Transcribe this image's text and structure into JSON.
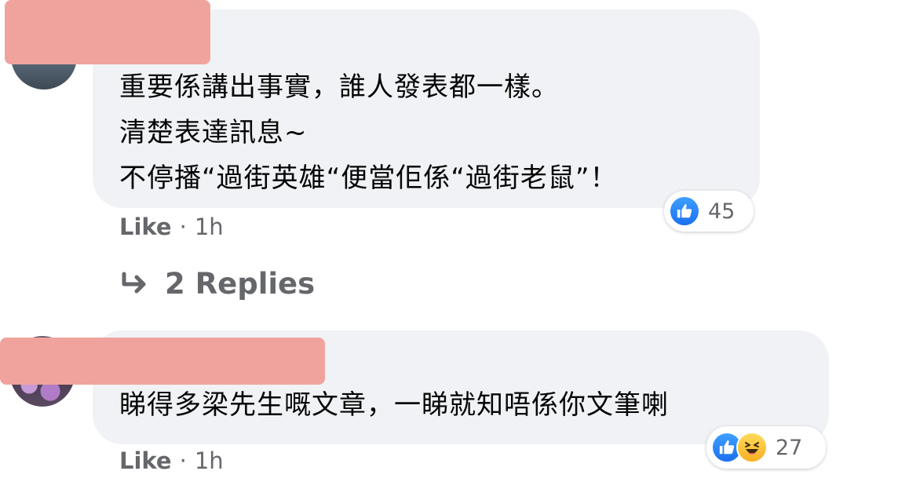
{
  "comments": [
    {
      "text": "重要係講出事實，誰人發表都一樣。\n清楚表達訊息~\n不停播“過街英雄“便當佢係“過街老鼠”！",
      "reaction_count": "45",
      "like_label": "Like",
      "separator": "·",
      "time": "1h",
      "reactions": [
        "like-icon"
      ]
    },
    {
      "text": "睇得多梁先生嘅文章，一睇就知唔係你文筆喇",
      "reaction_count": "27",
      "like_label": "Like",
      "separator": "·",
      "time": "1h",
      "reactions": [
        "like-icon",
        "haha-icon"
      ]
    }
  ],
  "replies_label": "2 Replies",
  "colors": {
    "bubble": "#f0f2f5",
    "meta_text": "#65676b",
    "like_blue": "#1b6ff0",
    "haha_yellow": "#f7b125",
    "redaction": "#f0a39c"
  }
}
